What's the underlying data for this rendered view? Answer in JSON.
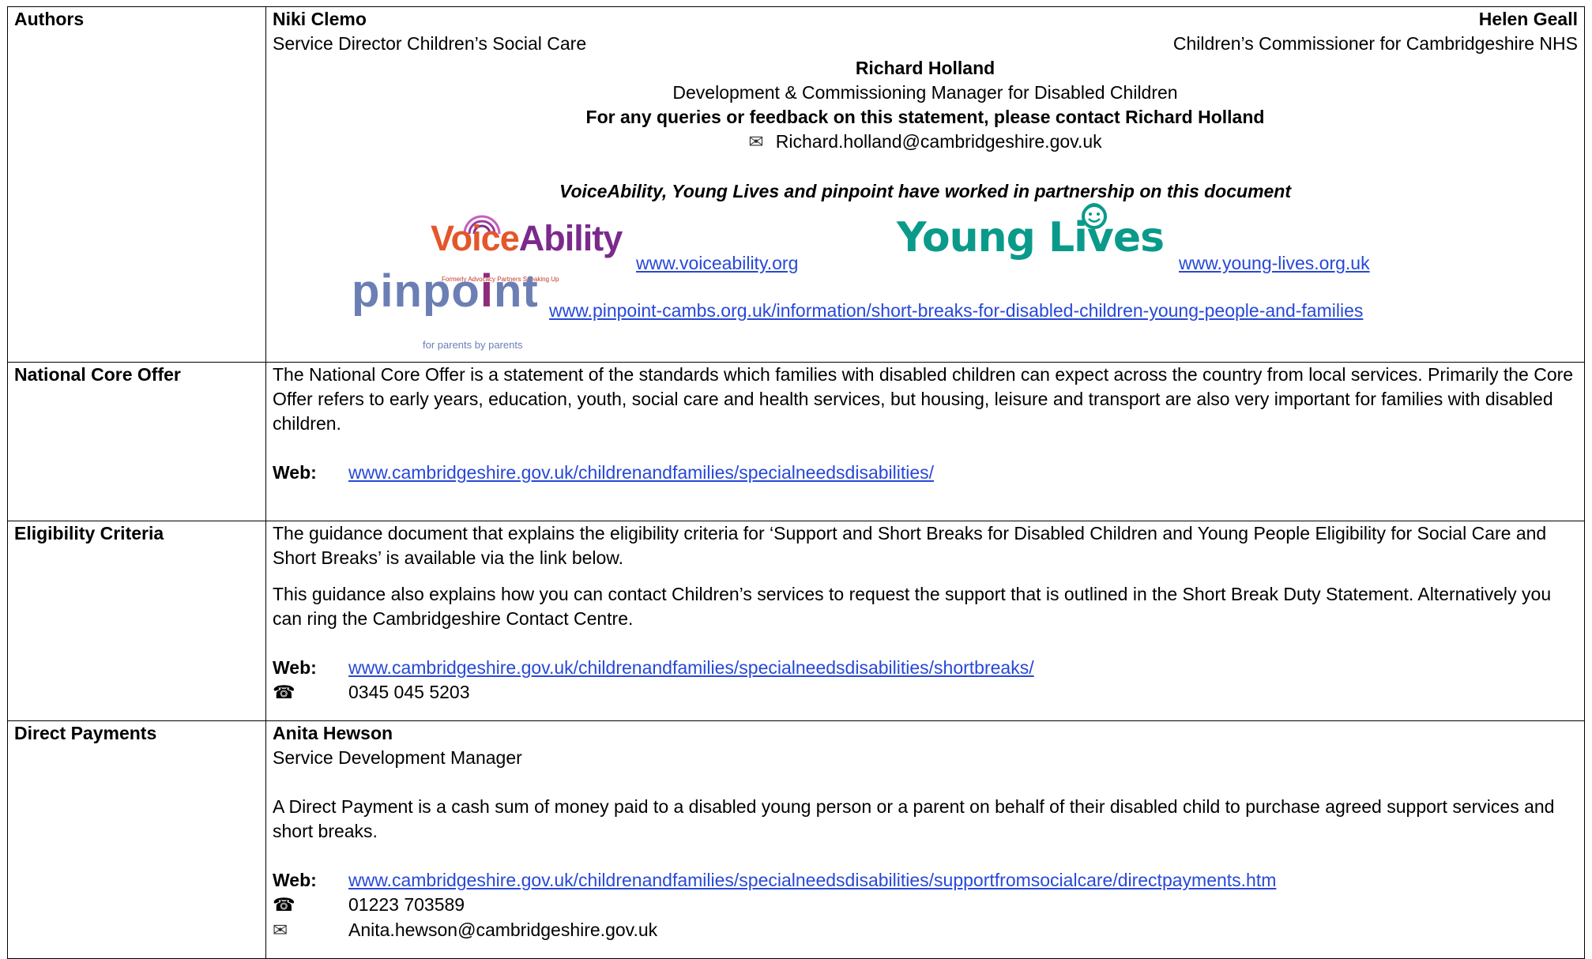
{
  "authors": {
    "label": "Authors",
    "left_name": "Niki Clemo",
    "left_role": "Service Director Children’s Social Care",
    "right_name": "Helen Geall",
    "right_role": "Children’s Commissioner for Cambridgeshire NHS",
    "center_name": "Richard Holland",
    "center_role": "Development & Commissioning Manager for Disabled Children",
    "queries": "For any queries or feedback on this statement, please contact Richard Holland",
    "email": "Richard.holland@cambridgeshire.gov.uk",
    "partnership": "VoiceAbility, Young Lives  and pinpoint have worked in partnership on this document",
    "voiceability": {
      "logo_text_a": "Voice",
      "logo_text_b": "Ability",
      "logo_sub": "Formerly Advocacy Partners Speaking Up",
      "link": "www.voiceability.org"
    },
    "younglives": {
      "logo_text": "Young Lives",
      "link": "www.young-lives.org.uk"
    },
    "pinpoint": {
      "logo_text_a": "pinpo",
      "logo_text_b": "i",
      "logo_text_c": "nt",
      "logo_sub": "for parents by parents",
      "link": "www.pinpoint-cambs.org.uk/information/short-breaks-for-disabled-children-young-people-and-families"
    }
  },
  "core_offer": {
    "label": "National Core Offer",
    "text": "The National Core Offer is a statement of the standards which families with disabled children can expect across the country from local services. Primarily the Core Offer refers to early years, education, youth, social care and health services, but housing, leisure and transport are also very important for families with disabled children.",
    "web_label": "Web:",
    "web_link": "www.cambridgeshire.gov.uk/childrenandfamilies/specialneedsdisabilities/"
  },
  "eligibility": {
    "label": "Eligibility Criteria",
    "text1": "The guidance document that explains the eligibility criteria for ‘Support and Short Breaks for Disabled Children and Young People Eligibility for Social Care and Short Breaks’ is available via the link below.",
    "text2": "This guidance also explains how you can contact Children’s services to request the support that is outlined in the Short Break Duty Statement.  Alternatively you can ring the Cambridgeshire Contact Centre.",
    "web_label": "Web:",
    "web_link": "www.cambridgeshire.gov.uk/childrenandfamilies/specialneedsdisabilities/shortbreaks/",
    "phone": "0345 045 5203"
  },
  "direct_payments": {
    "label": "Direct Payments",
    "name": "Anita Hewson",
    "role": "Service Development Manager",
    "text": "A Direct Payment is a cash sum of money paid to a disabled young person or a parent on behalf of their disabled child to purchase agreed support services and short breaks.",
    "web_label": "Web:",
    "web_link": "www.cambridgeshire.gov.uk/childrenandfamilies/specialneedsdisabilities/supportfromsocialcare/directpayments.htm",
    "phone": "01223 703589",
    "email": "Anita.hewson@cambridgeshire.gov.uk"
  },
  "icons": {
    "phone": "telephone-icon",
    "mail": "envelope-icon"
  },
  "colors": {
    "link": "#2748d8",
    "voiceability": "#7b2a8c",
    "younglives": "#0a9a8a",
    "pinpoint": "#6b7fb4"
  }
}
